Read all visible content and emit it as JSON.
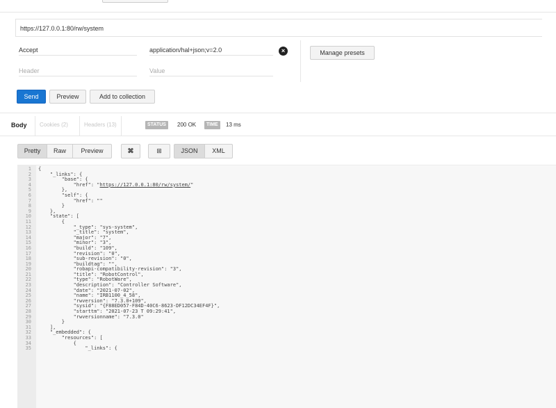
{
  "request": {
    "url": "https://127.0.0.1:80/rw/system",
    "headers": [
      {
        "key": "Accept",
        "value": "application/hal+json;v=2.0"
      }
    ],
    "new_header": {
      "key_placeholder": "Header",
      "value_placeholder": "Value"
    },
    "remove_icon": "×",
    "manage_presets_label": "Manage presets",
    "send_label": "Send",
    "preview_label": "Preview",
    "add_collection_label": "Add to collection"
  },
  "response": {
    "tabs": {
      "body": "Body",
      "cookies": "Cookies (2)",
      "headers": "Headers (13)"
    },
    "status_label": "STATUS",
    "status_value": "200 OK",
    "time_label": "TIME",
    "time_value": "13 ms",
    "view_buttons": {
      "pretty": "Pretty",
      "raw": "Raw",
      "preview": "Preview",
      "wrap_icon": "⌘",
      "copy_icon": "⊞",
      "json": "JSON",
      "xml": "XML"
    },
    "code_lines": [
      "{",
      "    \"_links\": {",
      "        \"base\": {",
      "            \"href\": \"https://127.0.0.1:80/rw/system/\"",
      "        },",
      "        \"self\": {",
      "            \"href\": \"\"",
      "        }",
      "    },",
      "    \"state\": [",
      "        {",
      "            \"_type\": \"sys-system\",",
      "            \"_title\": \"system\",",
      "            \"major\": \"7\",",
      "            \"minor\": \"3\",",
      "            \"build\": \"109\",",
      "            \"revision\": \"0\",",
      "            \"sub-revision\": \"0\",",
      "            \"buildtag\": \"\",",
      "            \"robapi-compatibility-revision\": \"3\",",
      "            \"title\": \"RobotControl\",",
      "            \"type\": \"RobotWare\",",
      "            \"description\": \"Controller Software\",",
      "            \"date\": \"2021-07-02\",",
      "            \"name\": \"IRB1100_4_58\",",
      "            \"rwversion\": \"7.3.0+109\",",
      "            \"sysid\": \"{F88ED057-F84D-40C6-8623-DF12DC34EF4F}\",",
      "            \"starttm\": \"2021-07-23 T 09:29:41\",",
      "            \"rwversionname\": \"7.3.0\"",
      "        }",
      "    ],",
      "    \"_embedded\": {",
      "        \"resources\": [",
      "            {",
      "                \"_links\": {"
    ]
  },
  "colors": {
    "send_button": "#1976d2",
    "badge": "#b5b5b5",
    "code_bg": "#f7f7f7"
  }
}
